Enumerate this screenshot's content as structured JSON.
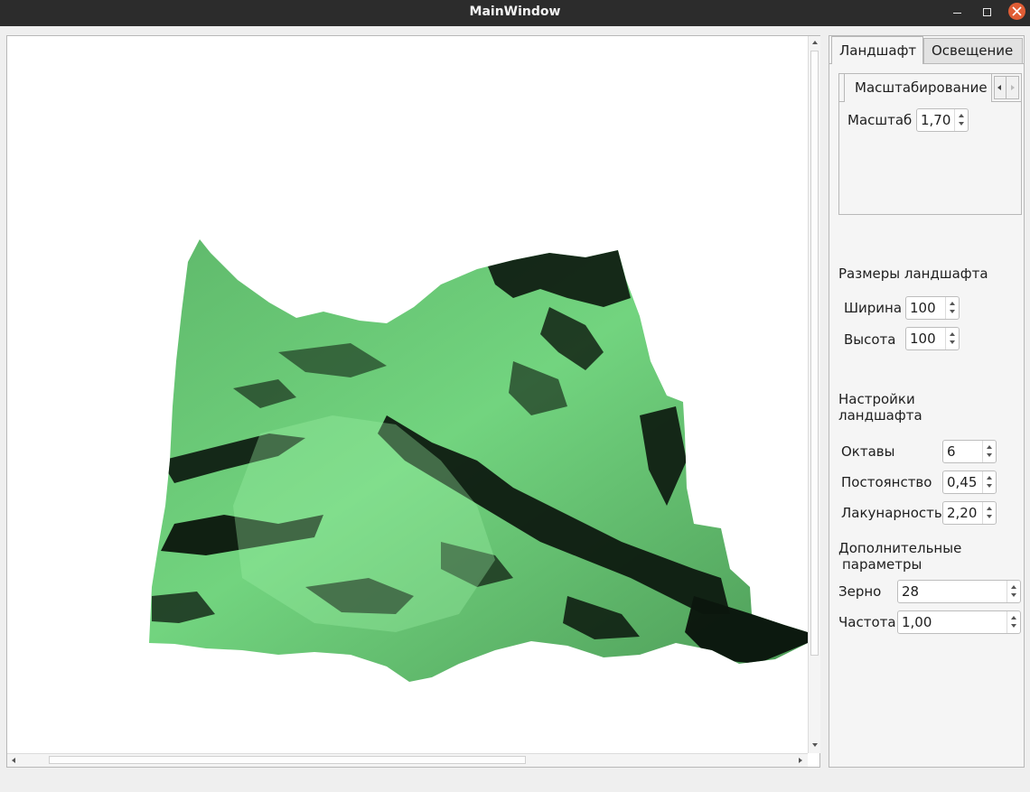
{
  "window": {
    "title": "MainWindow"
  },
  "tabs": {
    "landscape": "Ландшафт",
    "lighting": "Освещение"
  },
  "scaling": {
    "subtab": "Масштабирование",
    "scale_label": "Масштаб",
    "scale_value": "1,70"
  },
  "size": {
    "heading": "Размеры ландшафта",
    "width_label": "Ширина",
    "width_value": "100",
    "height_label": "Высота",
    "height_value": "100"
  },
  "settings": {
    "heading_line1": "Настройки",
    "heading_line2": "ландшафта",
    "octaves_label": "Октавы",
    "octaves_value": "6",
    "persistence_label": "Постоянство",
    "persistence_value": "0,45",
    "lacunarity_label": "Лакунарность",
    "lacunarity_value": "2,20"
  },
  "extra": {
    "heading_line1": "Дополнительные",
    "heading_line2": "параметры",
    "seed_label": "Зерно",
    "seed_value": "28",
    "frequency_label": "Частота",
    "frequency_value": "1,00"
  },
  "colors": {
    "terrain_light": "#6fd27c",
    "terrain_dark": "#0a140c",
    "close_button": "#e05d35"
  }
}
